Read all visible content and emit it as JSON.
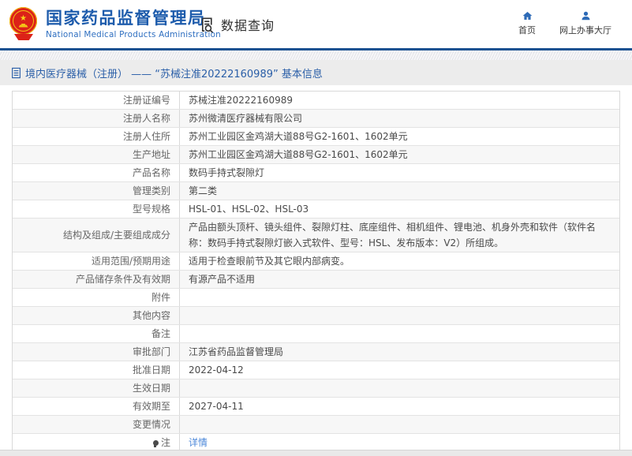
{
  "header": {
    "agency_cn": "国家药品监督管理局",
    "agency_en": "National Medical Products Administration",
    "nav_data_query": "数据查询",
    "nav_home": "首页",
    "nav_online_hall": "网上办事大厅"
  },
  "breadcrumb": {
    "title": "境内医疗器械（注册） —— “苏械注准20222160989” 基本信息"
  },
  "table": {
    "rows": [
      {
        "label": "注册证编号",
        "value": "苏械注准20222160989"
      },
      {
        "label": "注册人名称",
        "value": "苏州微清医疗器械有限公司"
      },
      {
        "label": "注册人住所",
        "value": "苏州工业园区金鸡湖大道88号G2-1601、1602单元"
      },
      {
        "label": "生产地址",
        "value": "苏州工业园区金鸡湖大道88号G2-1601、1602单元"
      },
      {
        "label": "产品名称",
        "value": "数码手持式裂隙灯"
      },
      {
        "label": "管理类别",
        "value": "第二类"
      },
      {
        "label": "型号规格",
        "value": "HSL-01、HSL-02、HSL-03"
      },
      {
        "label": "结构及组成/主要组成成分",
        "value": "产品由额头顶杆、镜头组件、裂隙灯柱、底座组件、相机组件、锂电池、机身外壳和软件（软件名称：数码手持式裂隙灯嵌入式软件、型号：HSL、发布版本：V2）所组成。"
      },
      {
        "label": "适用范围/预期用途",
        "value": "适用于检查眼前节及其它眼内部病变。"
      },
      {
        "label": "产品储存条件及有效期",
        "value": "有源产品不适用"
      },
      {
        "label": "附件",
        "value": ""
      },
      {
        "label": "其他内容",
        "value": ""
      },
      {
        "label": "备注",
        "value": ""
      },
      {
        "label": "审批部门",
        "value": "江苏省药品监督管理局"
      },
      {
        "label": "批准日期",
        "value": "2022-04-12"
      },
      {
        "label": "生效日期",
        "value": ""
      },
      {
        "label": "有效期至",
        "value": "2027-04-11"
      },
      {
        "label": "变更情况",
        "value": ""
      },
      {
        "label": "注",
        "value": "详情",
        "is_link": true,
        "note_icon": true
      }
    ]
  },
  "colors": {
    "accent_blue": "#1e5cac",
    "icon_blue": "#2e6bb7",
    "link_blue": "#4b87d9",
    "divider_navy": "#1c5191",
    "breadcrumb_bg": "#ececec",
    "row_alt_bg": "#f7f7f7",
    "emblem_red": "#dc2218",
    "emblem_gold": "#f3c217"
  }
}
